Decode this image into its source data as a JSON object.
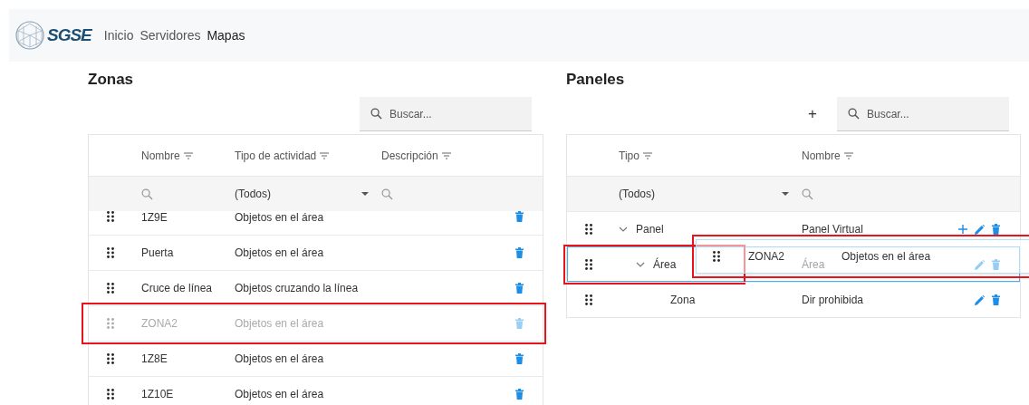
{
  "nav": {
    "brand": "SGSE",
    "links": [
      {
        "label": "Inicio",
        "selected": false
      },
      {
        "label": "Servidores",
        "selected": false
      },
      {
        "label": "Mapas",
        "selected": true
      }
    ]
  },
  "zonas": {
    "title": "Zonas",
    "search": {
      "placeholder": "Buscar..."
    },
    "columns": [
      "Nombre",
      "Tipo de actividad",
      "Descripción"
    ],
    "filter": {
      "type_value": "(Todos)"
    },
    "rows": [
      {
        "name": "1Z9E",
        "activity": "Objetos en el área",
        "dragging": false,
        "annotated": false
      },
      {
        "name": "Puerta",
        "activity": "Objetos en el área",
        "dragging": false,
        "annotated": false
      },
      {
        "name": "Cruce de línea",
        "activity": "Objetos cruzando la línea",
        "dragging": false,
        "annotated": false
      },
      {
        "name": "ZONA2",
        "activity": "Objetos en el área",
        "dragging": true,
        "annotated": true
      },
      {
        "name": "1Z8E",
        "activity": "Objetos en el área",
        "dragging": false,
        "annotated": false
      },
      {
        "name": "1Z10E",
        "activity": "Objetos en el área",
        "dragging": false,
        "annotated": false
      }
    ]
  },
  "paneles": {
    "title": "Paneles",
    "add_label": "+",
    "search": {
      "placeholder": "Buscar..."
    },
    "columns": [
      "Tipo",
      "Nombre"
    ],
    "filter": {
      "type_value": "(Todos)"
    },
    "rows": [
      {
        "type": "Panel",
        "name": "Panel Virtual",
        "expanded": true,
        "drop_target": false,
        "annotated": false,
        "can_add": true,
        "can_edit": true,
        "can_delete": true,
        "children": [
          {
            "type": "Área",
            "name": "Área",
            "expanded": true,
            "drop_target": true,
            "annotated": true,
            "can_add": false,
            "can_edit": true,
            "can_delete": true,
            "children": [
              {
                "type": "Zona",
                "name": "Dir prohibida",
                "drop_target": false,
                "annotated": false,
                "can_add": false,
                "can_edit": true,
                "can_delete": true
              }
            ]
          }
        ]
      }
    ]
  },
  "drag_preview": {
    "name": "ZONA2",
    "activity": "Objetos en el área",
    "annotated": true
  }
}
